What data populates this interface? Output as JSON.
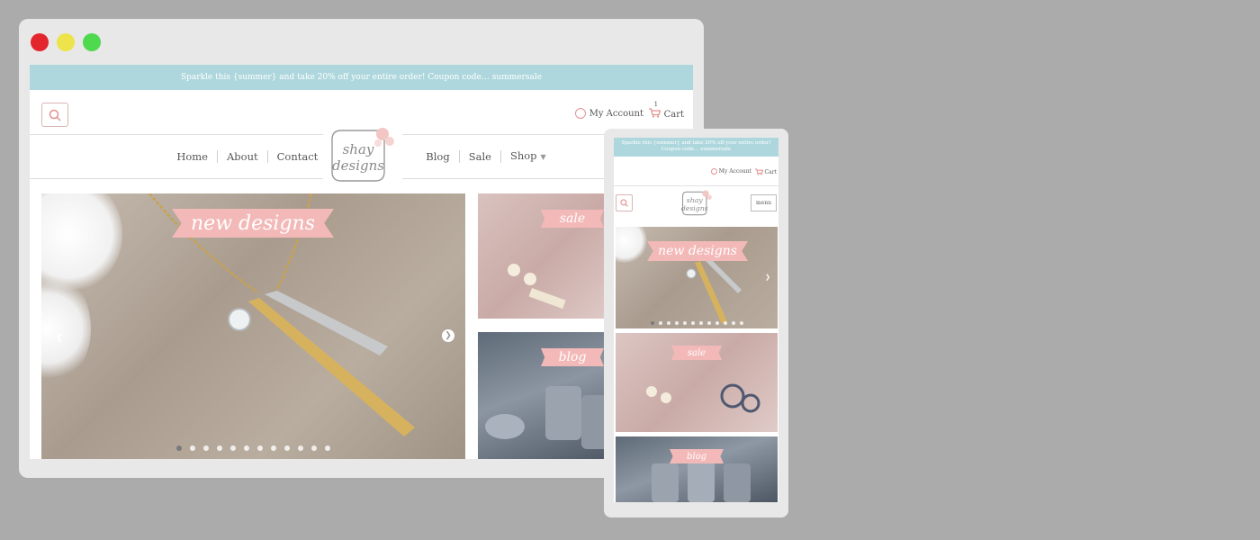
{
  "promo_text": "Sparkle this {summer} and take 20% off your entire order! Coupon code… summersale",
  "account_label": "My Account",
  "cart_label": "Cart",
  "cart_count": "1",
  "nav_left": [
    "Home",
    "About",
    "Contact"
  ],
  "nav_right": [
    "Blog",
    "Sale",
    "Shop"
  ],
  "logo_line1": "shay",
  "logo_line2": "designs",
  "hero_banner": "new designs",
  "sale_banner": "sale",
  "blog_banner": "blog",
  "tablet": {
    "promo_text": "Sparkle this {summer} and take 20% off your entire order! Coupon code… summersale",
    "account_label": "My Account",
    "cart_label": "Cart",
    "menu_label": "menu",
    "hero_banner": "new designs",
    "sale_banner": "sale",
    "blog_banner": "blog"
  },
  "colors": {
    "background": "#ababab",
    "promo_bar": "#aed7dd",
    "banner_pink": "#f3b9b8",
    "close": "#e3262e",
    "minimize": "#ede34a",
    "maximize": "#4fd94f"
  },
  "icons": [
    "search-icon",
    "account-icon",
    "cart-icon",
    "chevron-down-icon",
    "arrow-right-icon",
    "arrow-left-icon"
  ],
  "slider": {
    "total_dots": 12,
    "active_index": 0
  }
}
